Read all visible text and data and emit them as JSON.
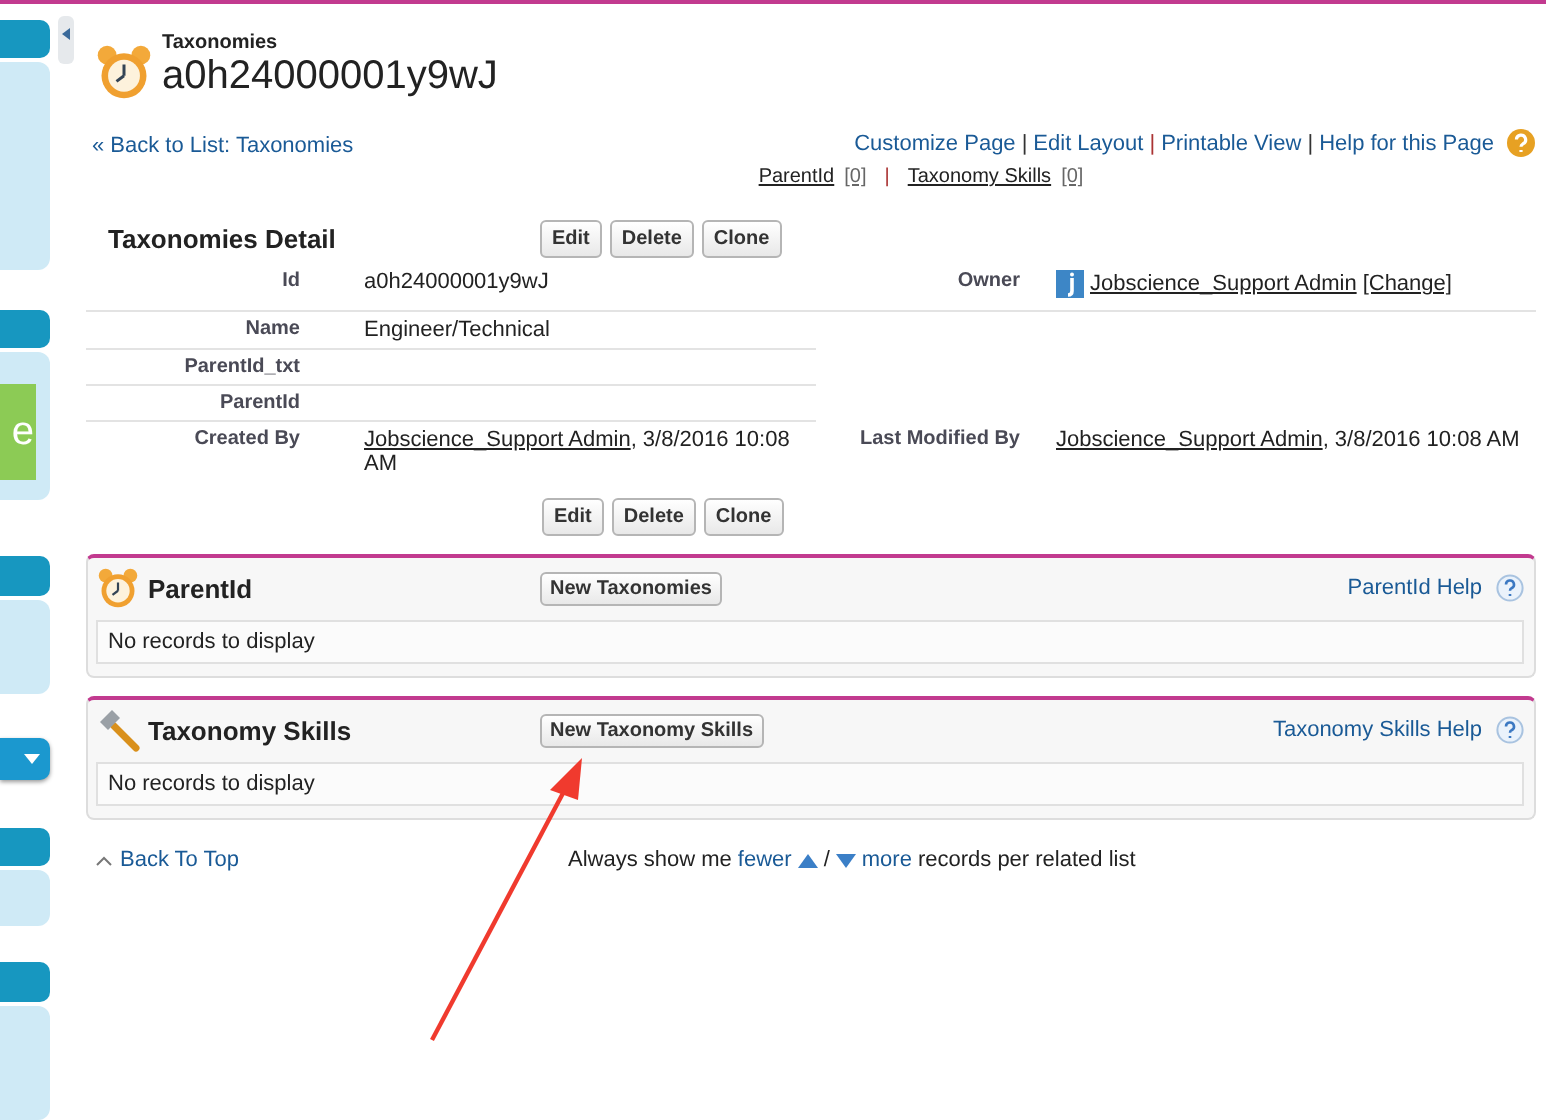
{
  "sidebar": {
    "tile_text": "e"
  },
  "header": {
    "object_type": "Taxonomies",
    "record_name": "a0h24000001y9wJ"
  },
  "top_links": [
    "Customize Page",
    "Edit Layout",
    "Printable View",
    "Help for this Page"
  ],
  "top_link_separators": [
    "|",
    "|",
    "|"
  ],
  "back_link": "« Back to List: Taxonomies",
  "related_links": [
    {
      "label": "ParentId",
      "count": "[0]"
    },
    {
      "label": "Taxonomy Skills",
      "count": "[0]"
    }
  ],
  "related_link_separator": "|",
  "detail": {
    "title": "Taxonomies Detail",
    "buttons": [
      "Edit",
      "Delete",
      "Clone"
    ],
    "rows": [
      {
        "left_label": "Id",
        "left_value": "a0h24000001y9wJ",
        "right_label": "Owner",
        "right_link": "Jobscience_Support Admin",
        "right_suffix": "[Change]"
      },
      {
        "left_label": "Name",
        "left_value": "Engineer/Technical"
      },
      {
        "left_label": "ParentId_txt"
      },
      {
        "left_label": "ParentId"
      },
      {
        "left_label": "Created By",
        "left_link": "Jobscience_Support Admin",
        "left_value": ", 3/8/2016 10:08 AM",
        "right_label": "Last Modified By",
        "right_link": "Jobscience_Support Admin",
        "right_suffix": ", 3/8/2016 10:08 AM"
      }
    ],
    "bottom_buttons": [
      "Edit",
      "Delete",
      "Clone"
    ]
  },
  "related_lists": [
    {
      "title": "ParentId",
      "button": "New Taxonomies",
      "help": "ParentId Help",
      "empty": "No records to display"
    },
    {
      "title": "Taxonomy Skills",
      "button": "New Taxonomy Skills",
      "help": "Taxonomy Skills Help",
      "empty": "No records to display"
    }
  ],
  "footer": {
    "back_to_top": "Back To Top",
    "prefix": "Always show me",
    "fewer": "fewer",
    "slash": "/",
    "more": "more",
    "suffix": "records per related list"
  }
}
